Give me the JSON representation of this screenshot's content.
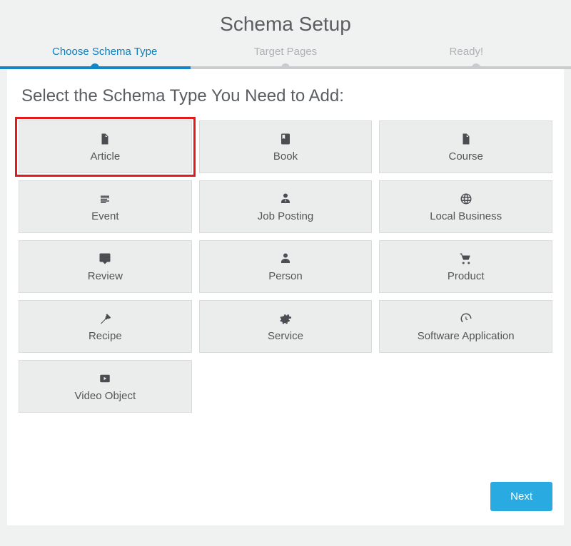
{
  "title": "Schema Setup",
  "steps": [
    {
      "label": "Choose Schema Type",
      "active": true
    },
    {
      "label": "Target Pages",
      "active": false
    },
    {
      "label": "Ready!",
      "active": false
    }
  ],
  "heading": "Select the Schema Type You Need to Add:",
  "tiles": [
    {
      "label": "Article",
      "icon": "file",
      "highlighted": true
    },
    {
      "label": "Book",
      "icon": "book",
      "highlighted": false
    },
    {
      "label": "Course",
      "icon": "file",
      "highlighted": false
    },
    {
      "label": "Event",
      "icon": "calendar",
      "highlighted": false
    },
    {
      "label": "Job Posting",
      "icon": "user-tie",
      "highlighted": false
    },
    {
      "label": "Local Business",
      "icon": "globe",
      "highlighted": false
    },
    {
      "label": "Review",
      "icon": "comment",
      "highlighted": false
    },
    {
      "label": "Person",
      "icon": "user",
      "highlighted": false
    },
    {
      "label": "Product",
      "icon": "cart",
      "highlighted": false
    },
    {
      "label": "Recipe",
      "icon": "carrot",
      "highlighted": false
    },
    {
      "label": "Service",
      "icon": "gear",
      "highlighted": false
    },
    {
      "label": "Software Application",
      "icon": "dashboard",
      "highlighted": false
    },
    {
      "label": "Video Object",
      "icon": "play",
      "highlighted": false
    }
  ],
  "next_label": "Next"
}
